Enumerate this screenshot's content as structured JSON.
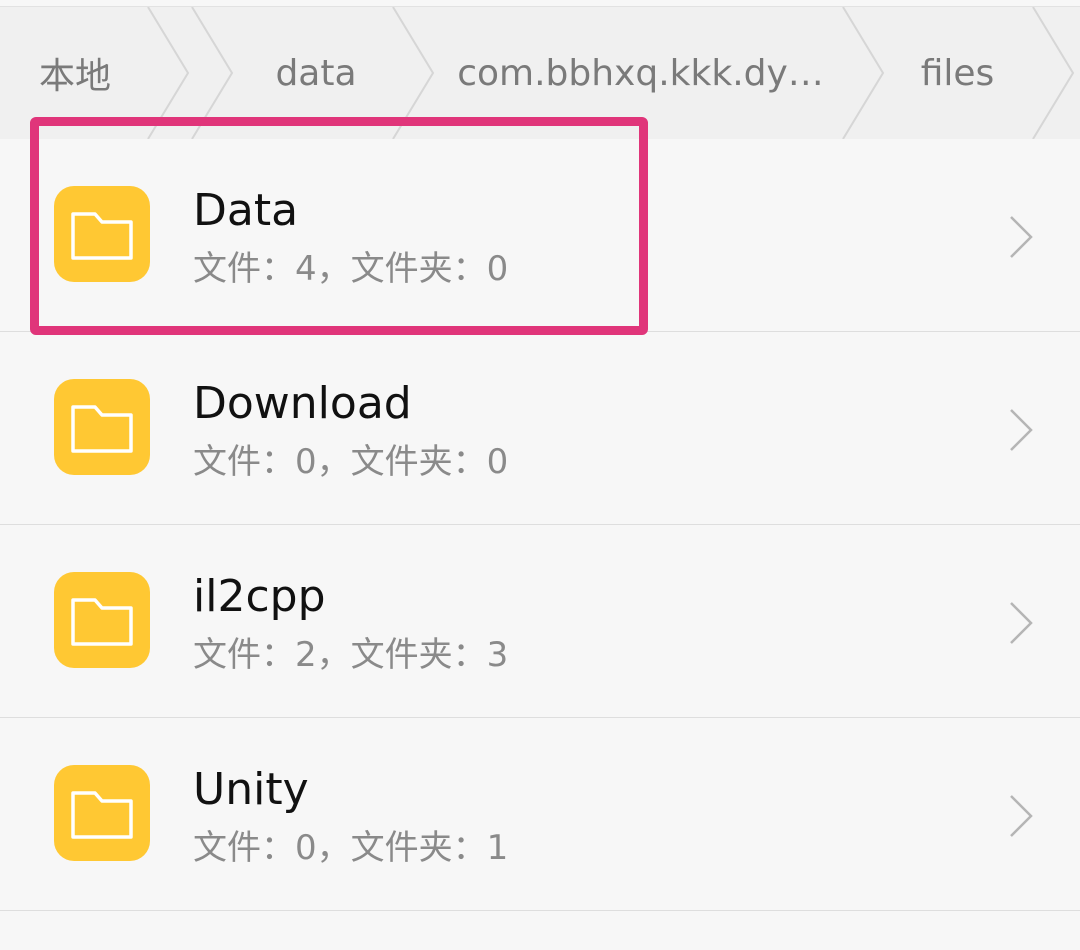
{
  "breadcrumb": {
    "items": [
      {
        "label": "本地"
      },
      {
        "label": "data"
      },
      {
        "label": "com.bbhxq.kkk.dy…"
      },
      {
        "label": "files"
      }
    ]
  },
  "folders": [
    {
      "name": "Data",
      "summary": "文件：4，文件夹：0",
      "icon": "folder-icon"
    },
    {
      "name": "Download",
      "summary": "文件：0，文件夹：0",
      "icon": "folder-icon"
    },
    {
      "name": "il2cpp",
      "summary": "文件：2，文件夹：3",
      "icon": "folder-icon"
    },
    {
      "name": "Unity",
      "summary": "文件：0，文件夹：1",
      "icon": "folder-icon"
    }
  ],
  "colors": {
    "folder": "#ffc833",
    "highlight": "#e0357a",
    "background": "#f7f7f7"
  }
}
